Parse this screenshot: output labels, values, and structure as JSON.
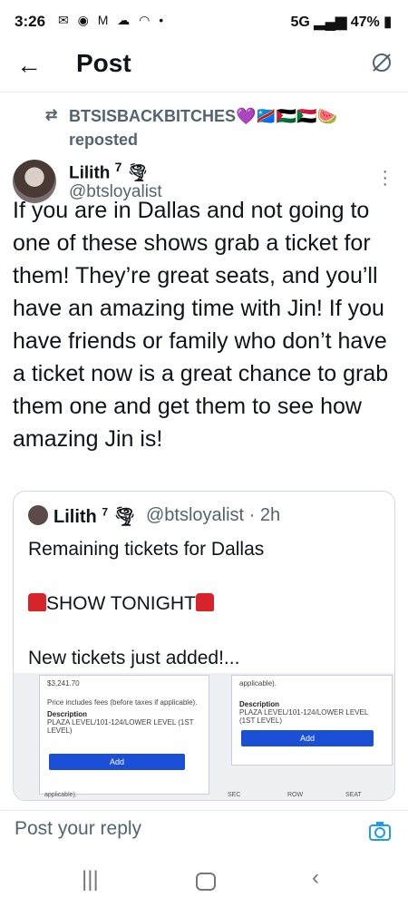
{
  "status_bar": {
    "time": "3:26",
    "signal": "5G",
    "battery": "47%"
  },
  "header": {
    "title": "Post"
  },
  "repost": {
    "by": "BTSISBACKBITCHES💜🇨🇩🇵🇸🇸🇩🍉",
    "label": "reposted"
  },
  "post": {
    "author": "Lilith",
    "badge": "7",
    "handle": "@btsloyalist",
    "text": "If you are in Dallas and not going to one of these shows grab a ticket for them! They’re great seats, and you’ll have an amazing time with Jin! If you have friends or family who don’t have a ticket now is a great chance to grab them one and get them to see how amazing Jin is!"
  },
  "quote": {
    "author": "Lilith",
    "badge": "7",
    "handle_time": "@btsloyalist · 2h",
    "line1": "Remaining tickets for Dallas",
    "line2": "SHOW TONIGHT",
    "line3": "New tickets just added!...",
    "media": {
      "card1_top": "$3,241.70",
      "card1_note": "Price includes fees (before taxes if applicable).",
      "card1_desc_label": "Description",
      "card1_desc": "PLAZA LEVEL/101-124/LOWER LEVEL (1ST LEVEL)",
      "add_label": "Add",
      "card2_top": "applicable).",
      "card2_desc_label": "Description",
      "card2_desc": "PLAZA LEVEL/101-124/LOWER LEVEL (1ST LEVEL)",
      "bottom_note": "applicable).",
      "sec": "SEC",
      "row": "ROW",
      "seat": "SEAT"
    }
  },
  "reply": {
    "placeholder": "Post your reply"
  },
  "icons": [
    "back-arrow-icon",
    "grok-icon",
    "repost-icon",
    "more-icon",
    "camera-icon",
    "recent-apps-icon",
    "home-icon",
    "nav-back-icon"
  ]
}
